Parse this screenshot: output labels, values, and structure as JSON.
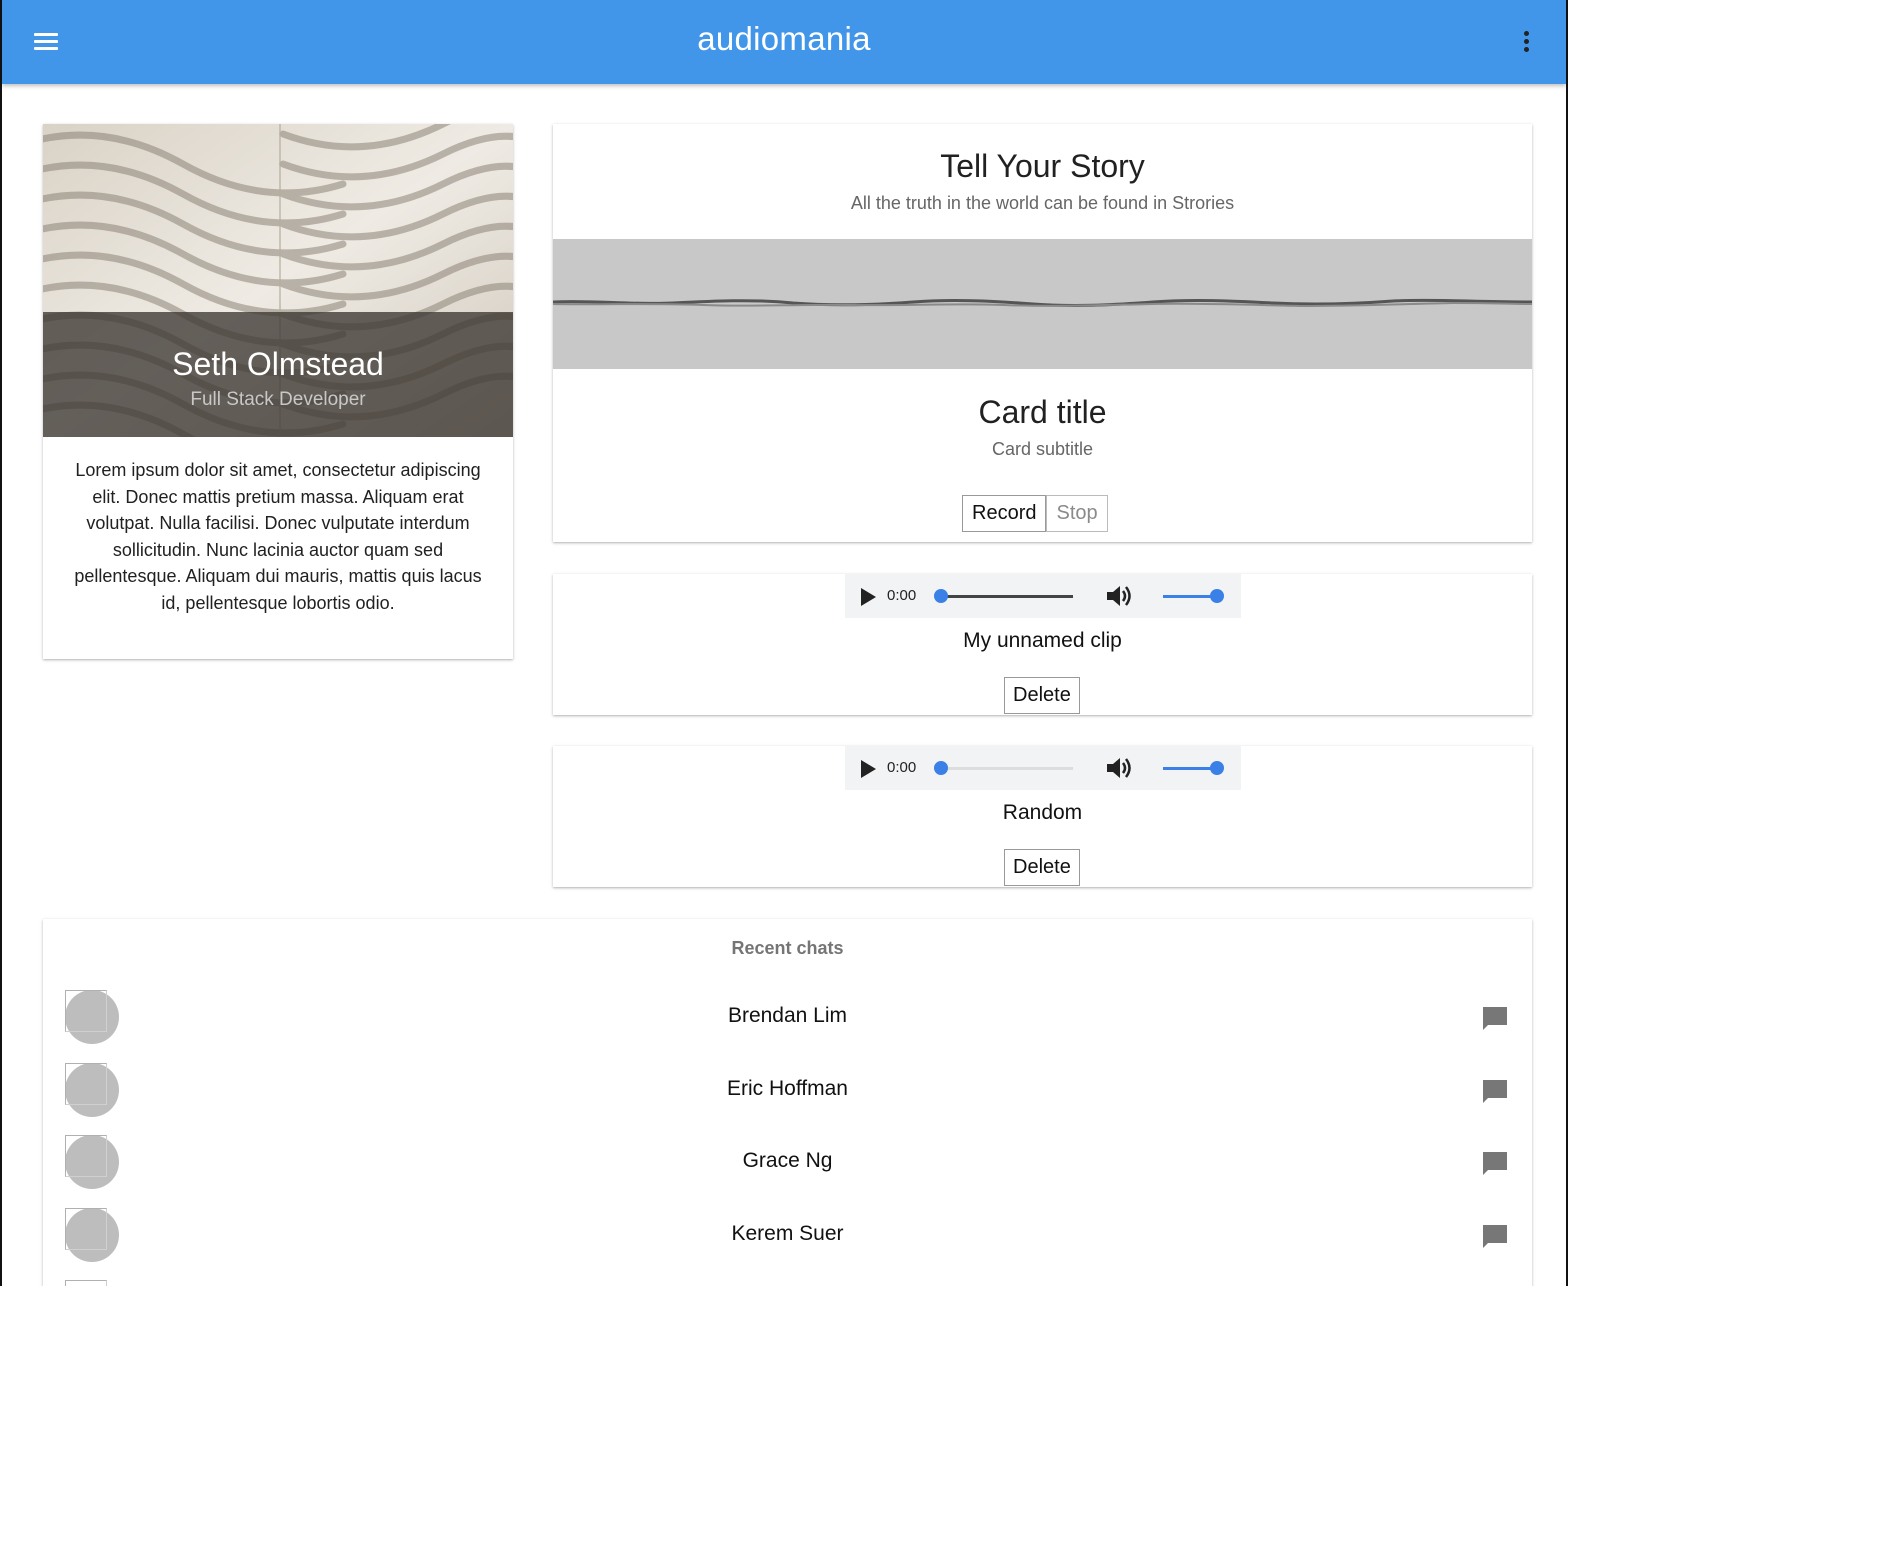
{
  "app": {
    "title": "audiomania",
    "accent_color": "#4296ea",
    "menu_icon": "hamburger-menu-icon",
    "more_icon": "more-vertical-icon"
  },
  "profile": {
    "name": "Seth Olmstead",
    "role": "Full Stack Developer",
    "bio": "Lorem ipsum dolor sit amet, consectetur adipiscing elit. Donec mattis pretium massa. Aliquam erat volutpat. Nulla facilisi. Donec vulputate interdum sollicitudin. Nunc lacinia auctor quam sed pellentesque. Aliquam dui mauris, mattis quis lacus id, pellentesque lobortis odio."
  },
  "story": {
    "title": "Tell Your Story",
    "subtitle": "All the truth in the world can be found in Strories",
    "card_title": "Card title",
    "card_subtitle": "Card subtitle",
    "record_label": "Record",
    "stop_label": "Stop",
    "stop_disabled": true
  },
  "clips": [
    {
      "name": "My unnamed clip",
      "time": "0:00",
      "progress": 0.0,
      "volume": 1.0,
      "delete_label": "Delete"
    },
    {
      "name": "Random",
      "time": "0:00",
      "progress": 0.0,
      "volume": 1.0,
      "delete_label": "Delete"
    }
  ],
  "chats": {
    "header": "Recent chats",
    "items": [
      {
        "name": "Brendan Lim"
      },
      {
        "name": "Eric Hoffman"
      },
      {
        "name": "Grace Ng"
      },
      {
        "name": "Kerem Suer"
      }
    ],
    "chat_icon": "chat-bubble-icon"
  }
}
